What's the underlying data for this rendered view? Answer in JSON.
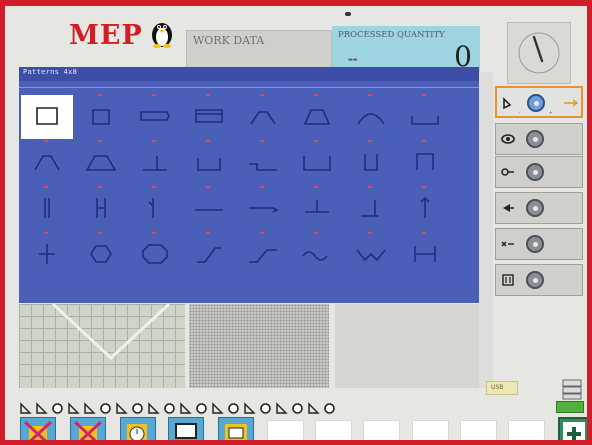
{
  "header": {
    "logo_text": "MEP",
    "work_data_label": "WORK DATA",
    "processed_label": "PROCESSED QUANTITY",
    "processed_value": "0"
  },
  "dialog": {
    "title": "Patterns 4x8",
    "selected_index": 0,
    "patterns": [
      "open-rect",
      "rect",
      "bar-right",
      "frame",
      "trapezoid-arc",
      "trapezoid",
      "arch",
      "bracket-bottom",
      "open-trapezoid",
      "trapezoid-flat",
      "step-left",
      "u-shallow",
      "u-step",
      "u-wide",
      "u-narrow",
      "u-tall",
      "double-vertical",
      "double-flat",
      "double-left",
      "line-h",
      "line-h-arrow",
      "t-shape",
      "step-up",
      "single-vertical",
      "cross",
      "hexagon",
      "octagon",
      "z-diag",
      "zig-step",
      "wave",
      "w-shape",
      "h-shape"
    ]
  },
  "controls": [
    {
      "name": "corner-control",
      "icon": "corner-icon"
    },
    {
      "name": "eye-control",
      "icon": "eye-icon"
    },
    {
      "name": "pin-control",
      "icon": "pin-icon"
    },
    {
      "name": "cone-control",
      "icon": "cone-icon"
    },
    {
      "name": "link-control",
      "icon": "link-icon"
    },
    {
      "name": "length-control",
      "icon": "length-icon"
    }
  ],
  "status": {
    "usb_label": "USB"
  },
  "colors": {
    "frame": "#d01f2a",
    "dialog_bg": "#4a5fb7",
    "accent_orange": "#e6932d",
    "processed_bg": "#9ed3e2"
  }
}
